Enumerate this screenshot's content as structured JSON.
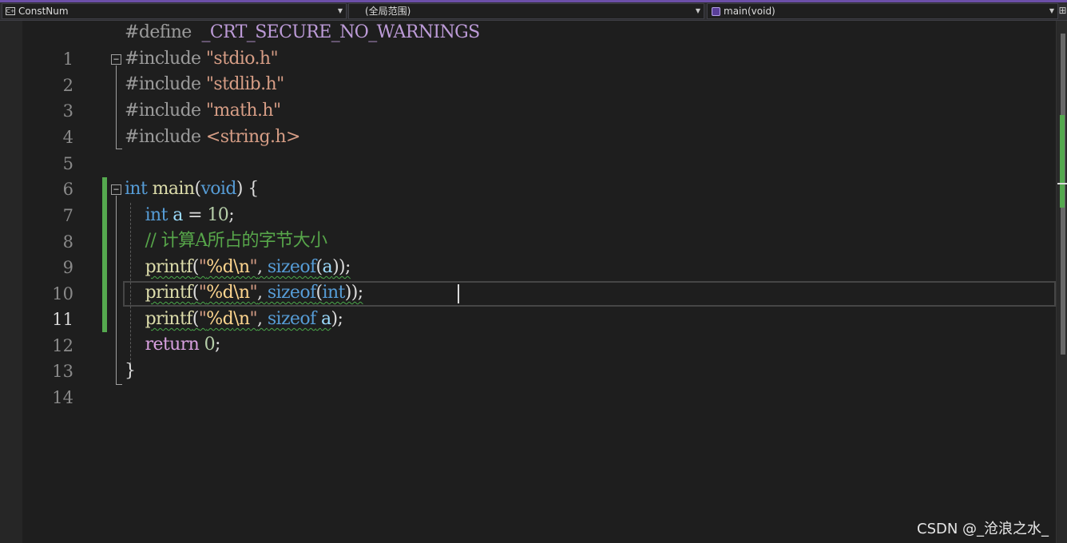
{
  "navbar": {
    "project_label": "ConstNum",
    "scope_label": "(全局范围)",
    "member_label": "main(void)",
    "project_icon": "project-icon",
    "member_icon": "method-icon",
    "split_glyph": "⊞"
  },
  "editor": {
    "current_line": 11,
    "lines": [
      {
        "n": "1"
      },
      {
        "n": "2"
      },
      {
        "n": "3"
      },
      {
        "n": "4"
      },
      {
        "n": "5"
      },
      {
        "n": "6"
      },
      {
        "n": "7"
      },
      {
        "n": "8"
      },
      {
        "n": "9"
      },
      {
        "n": "10"
      },
      {
        "n": "11"
      },
      {
        "n": "12"
      },
      {
        "n": "13"
      },
      {
        "n": "14"
      }
    ],
    "tokens": {
      "l1_define": "#define",
      "l1_macro": "_CRT_SECURE_NO_WARNINGS",
      "include": "#include",
      "l2_str": "\"stdio.h\"",
      "l3_str": "\"stdlib.h\"",
      "l4_str": "\"math.h\"",
      "l5_str": "<string.h>",
      "l7_int": "int",
      "l7_main": "main",
      "l7_open": "(",
      "l7_void": "void",
      "l7_close": ") {",
      "l8_int": "int",
      "l8_a": "a",
      "l8_eq": " = ",
      "l8_num": "10",
      "l8_semi": ";",
      "l9_comment": "// 计算A所占的字节大小",
      "printf": "printf",
      "paren_open": "(",
      "q_open": "\"",
      "fmt": "%d",
      "esc_n": "\\n",
      "q_close": "\"",
      "comma": ", ",
      "sizeof": "sizeof",
      "l10_arg": "a",
      "l10_end": "));",
      "l11_arg": "int",
      "l11_end": "));",
      "l12_space": " ",
      "l12_arg": "a",
      "l12_end": ");",
      "l13_return": "return",
      "l13_zero": " 0",
      "l13_semi": ";",
      "l14_brace": "}"
    }
  },
  "watermark": "CSDN @_沧浪之水_",
  "colors": {
    "background": "#1e1e1e",
    "keyword": "#569cd6",
    "string": "#d69d85",
    "function": "#dcdcaa",
    "comment": "#57a64a",
    "number": "#b5cea8",
    "change_bar": "#55a94f",
    "nav_accent": "#6c4fa8"
  }
}
